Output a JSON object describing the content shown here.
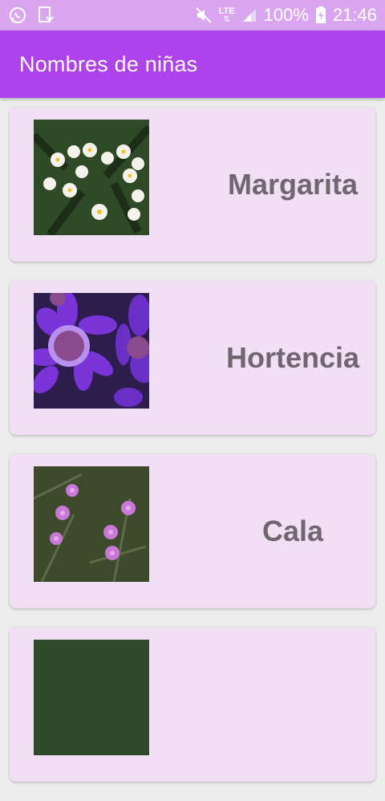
{
  "status_bar": {
    "network_label": "LTE",
    "battery_text": "100%",
    "time": "21:46",
    "icons": [
      "whatsapp-icon",
      "download-icon",
      "mute-icon",
      "signal-icon",
      "battery-icon"
    ]
  },
  "app_bar": {
    "title": "Nombres de niñas"
  },
  "colors": {
    "status_bar": "#d9a6ef",
    "app_bar": "#ae42ec",
    "card": "#f1dff5",
    "card_text": "#6f6670",
    "background": "#ececec"
  },
  "items": [
    {
      "name": "Margarita",
      "image": "white-flowers-photo"
    },
    {
      "name": "Hortencia",
      "image": "purple-daisy-photo"
    },
    {
      "name": "Cala",
      "image": "pink-wildflowers-photo"
    },
    {
      "name": "",
      "image": "flower-photo"
    }
  ]
}
